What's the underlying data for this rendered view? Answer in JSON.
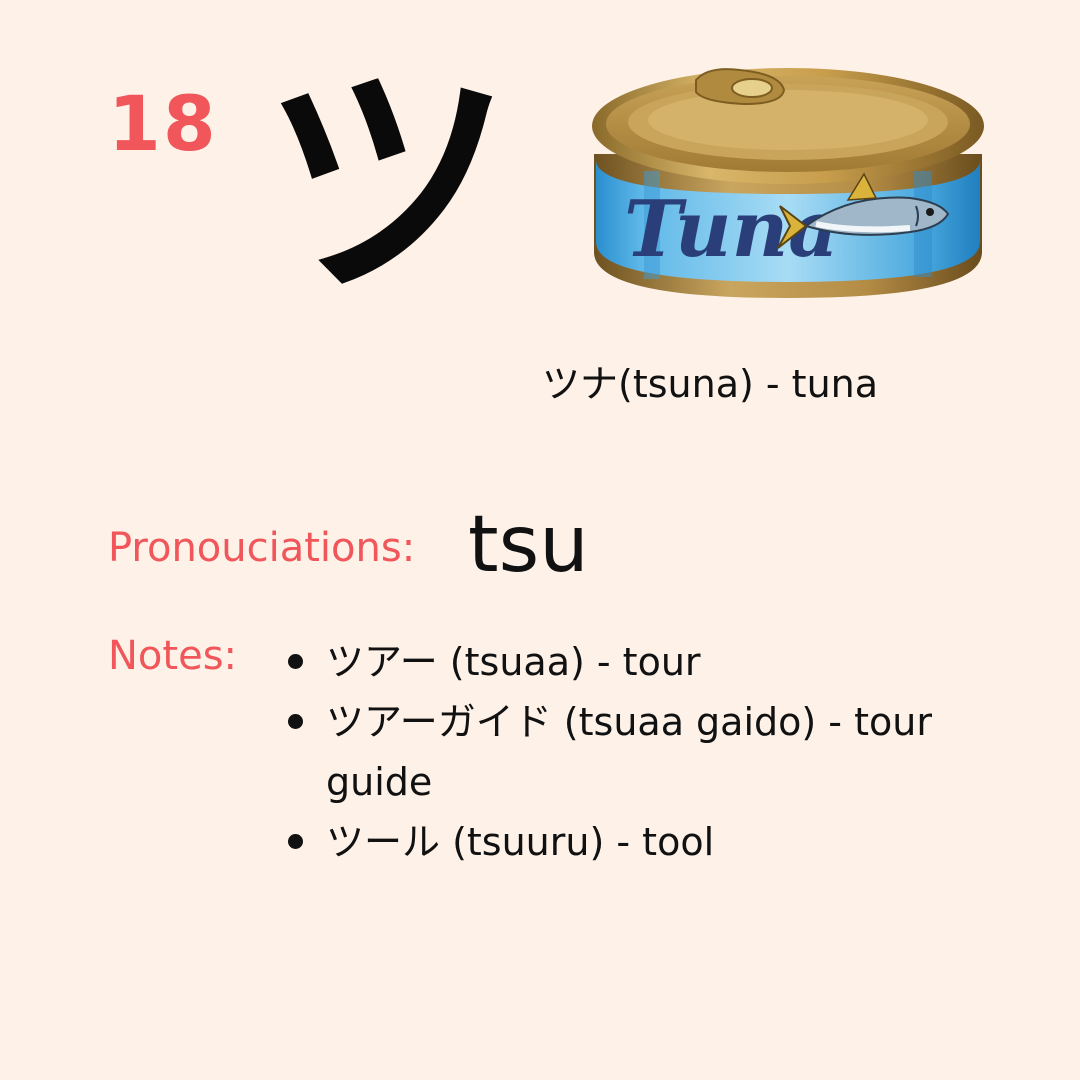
{
  "card": {
    "number": "18",
    "kana": "ツ",
    "image": {
      "icon": "tuna-can-icon",
      "label_text": "Tuna"
    },
    "caption": "ツナ(tsuna) - tuna",
    "pronunciation_label": "Pronouciations:",
    "pronunciation_value": "tsu",
    "notes_label": "Notes:",
    "notes": [
      "ツアー (tsuaa) - tour",
      "ツアーガイド (tsuaa gaido) - tour guide",
      "ツール (tsuuru) - tool"
    ]
  },
  "colors": {
    "background": "#fdf1e8",
    "accent": "#f0565a",
    "text": "#111111"
  }
}
